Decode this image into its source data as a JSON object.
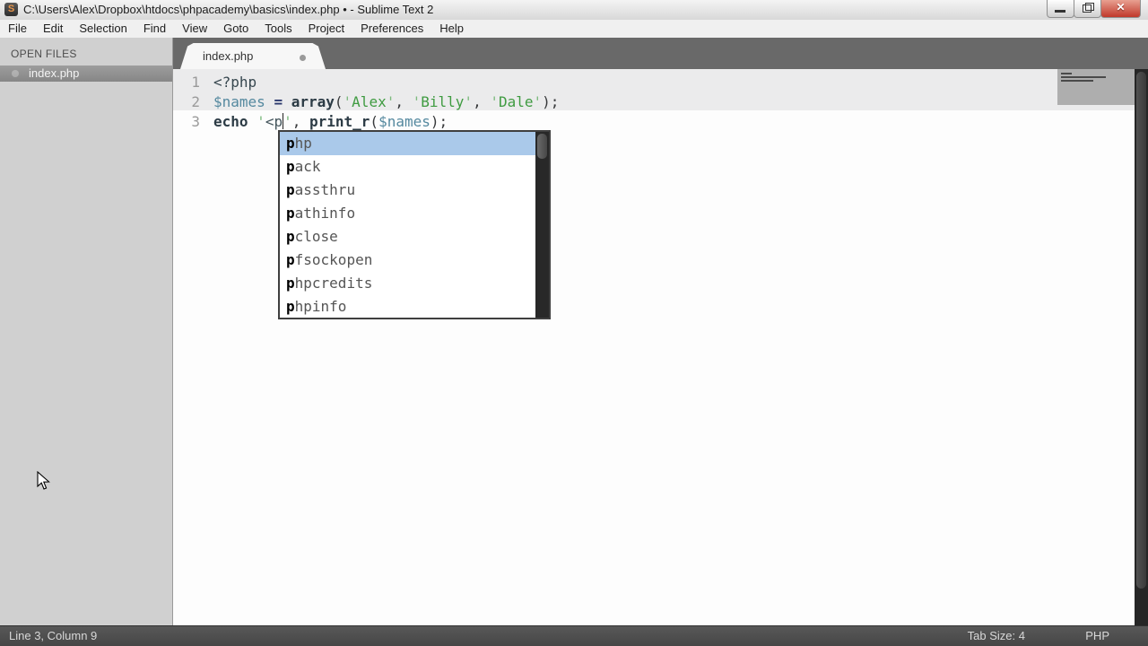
{
  "window": {
    "title": "C:\\Users\\Alex\\Dropbox\\htdocs\\phpacademy\\basics\\index.php • - Sublime Text 2"
  },
  "menu": {
    "items": [
      "File",
      "Edit",
      "Selection",
      "Find",
      "View",
      "Goto",
      "Tools",
      "Project",
      "Preferences",
      "Help"
    ]
  },
  "sidebar": {
    "header": "OPEN FILES",
    "files": [
      "index.php"
    ]
  },
  "tabs": [
    {
      "label": "index.php",
      "modified": true
    }
  ],
  "editor": {
    "lines": [
      {
        "number": "1",
        "tokens": [
          {
            "c": "tag",
            "t": "<?php"
          }
        ]
      },
      {
        "number": "2",
        "tokens": [
          {
            "c": "var",
            "t": "$names"
          },
          {
            "c": "plain",
            "t": " "
          },
          {
            "c": "op",
            "t": "="
          },
          {
            "c": "plain",
            "t": " "
          },
          {
            "c": "kw",
            "t": "array"
          },
          {
            "c": "plain",
            "t": "("
          },
          {
            "c": "strq",
            "t": "'"
          },
          {
            "c": "str",
            "t": "Alex"
          },
          {
            "c": "strq",
            "t": "'"
          },
          {
            "c": "plain",
            "t": ", "
          },
          {
            "c": "strq",
            "t": "'"
          },
          {
            "c": "str",
            "t": "Billy"
          },
          {
            "c": "strq",
            "t": "'"
          },
          {
            "c": "plain",
            "t": ", "
          },
          {
            "c": "strq",
            "t": "'"
          },
          {
            "c": "str",
            "t": "Dale"
          },
          {
            "c": "strq",
            "t": "'"
          },
          {
            "c": "plain",
            "t": ");"
          }
        ]
      },
      {
        "number": "3",
        "tokens": [
          {
            "c": "kw",
            "t": "echo"
          },
          {
            "c": "plain",
            "t": " "
          },
          {
            "c": "strq",
            "t": "'"
          },
          {
            "c": "strd",
            "t": "<p"
          },
          {
            "c": "caret",
            "t": ""
          },
          {
            "c": "strq",
            "t": "'"
          },
          {
            "c": "plain",
            "t": ", "
          },
          {
            "c": "kw",
            "t": "print_r"
          },
          {
            "c": "plain",
            "t": "("
          },
          {
            "c": "var",
            "t": "$names"
          },
          {
            "c": "plain",
            "t": ");"
          }
        ]
      }
    ]
  },
  "autocomplete": {
    "selected_index": 0,
    "bold_prefix_length": 1,
    "items": [
      "php",
      "pack",
      "passthru",
      "pathinfo",
      "pclose",
      "pfsockopen",
      "phpcredits",
      "phpinfo"
    ]
  },
  "statusbar": {
    "position": "Line 3, Column 9",
    "tab_size": "Tab Size: 4",
    "syntax": "PHP"
  },
  "colors": {
    "selection_blue": "#aac9ea",
    "string_green": "#3f9b41",
    "variable_teal": "#55899f",
    "keyword_dark": "#2c3b45",
    "tabbar_gray": "#696969",
    "statusbar_gray": "#4c4c4c",
    "close_button_red": "#c0392b"
  }
}
